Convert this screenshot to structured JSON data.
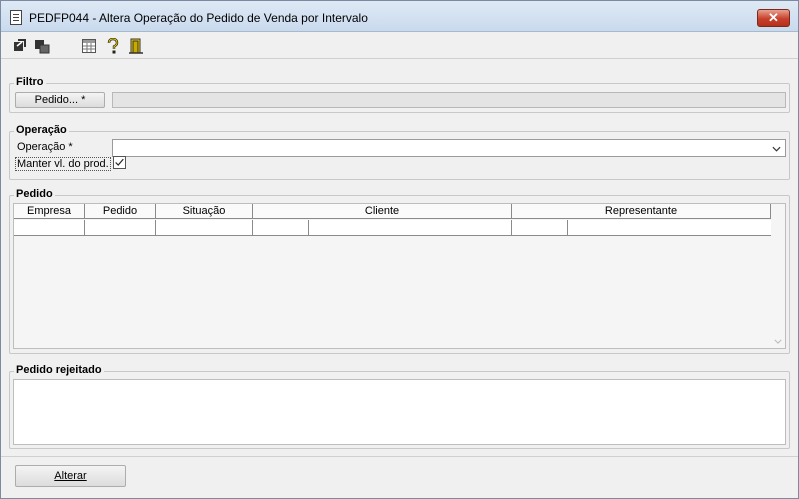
{
  "window": {
    "title": "PEDFP044 - Altera Operação do Pedido de Venda por Intervalo",
    "close_label": "✕"
  },
  "toolbar": {
    "icons": [
      "back-icon",
      "copy-icon",
      "calculator-icon",
      "help-icon",
      "exit-icon"
    ]
  },
  "filtro": {
    "legend": "Filtro",
    "pedido_button": "Pedido... *",
    "pedido_value": ""
  },
  "operacao": {
    "legend": "Operação",
    "operacao_label": "Operação *",
    "operacao_value": "",
    "manter_label": "Manter vl. do prod.",
    "manter_checked": true
  },
  "pedido": {
    "legend": "Pedido",
    "columns": [
      "Empresa",
      "Pedido",
      "Situação",
      "Cliente",
      "Representante"
    ],
    "rows": [
      [
        "",
        "",
        "",
        "",
        "",
        "",
        ""
      ]
    ]
  },
  "rejeitado": {
    "legend": "Pedido rejeitado",
    "value": ""
  },
  "footer": {
    "alterar_label": "Alterar"
  }
}
